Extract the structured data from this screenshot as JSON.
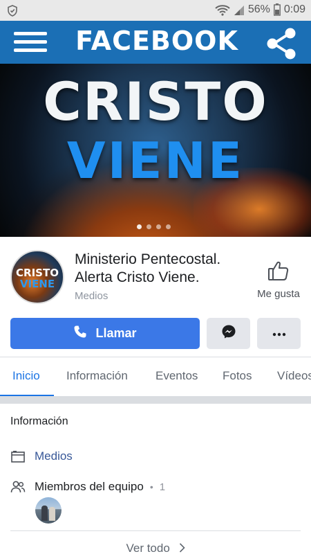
{
  "status_bar": {
    "battery": "56%",
    "time": "0:09"
  },
  "app_bar": {
    "title": "FACEBOOK"
  },
  "cover": {
    "line1": "CRISTO",
    "line2": "VIENE",
    "slides": 4,
    "active_slide": 1
  },
  "page": {
    "name": "Ministerio Pentecostal. Alerta Cristo Viene.",
    "category": "Medios",
    "avatar_text_1": "CRISTO",
    "avatar_text_2": "VIENE",
    "like_label": "Me gusta"
  },
  "actions": {
    "call_label": "Llamar",
    "message_icon": "messenger-icon",
    "more_icon": "more-icon"
  },
  "tabs": [
    {
      "label": "Inicio",
      "active": true
    },
    {
      "label": "Información",
      "active": false
    },
    {
      "label": "Eventos",
      "active": false
    },
    {
      "label": "Fotos",
      "active": false
    },
    {
      "label": "Vídeos",
      "active": false
    }
  ],
  "info": {
    "title": "Información",
    "category_link": "Medios",
    "team_label": "Miembros del equipo",
    "team_separator": "•",
    "team_count": "1",
    "see_all": "Ver todo"
  },
  "colors": {
    "app_bar": "#1b6fb5",
    "primary_button": "#3b78e7",
    "active_tab": "#1b74e4",
    "link": "#385898"
  }
}
